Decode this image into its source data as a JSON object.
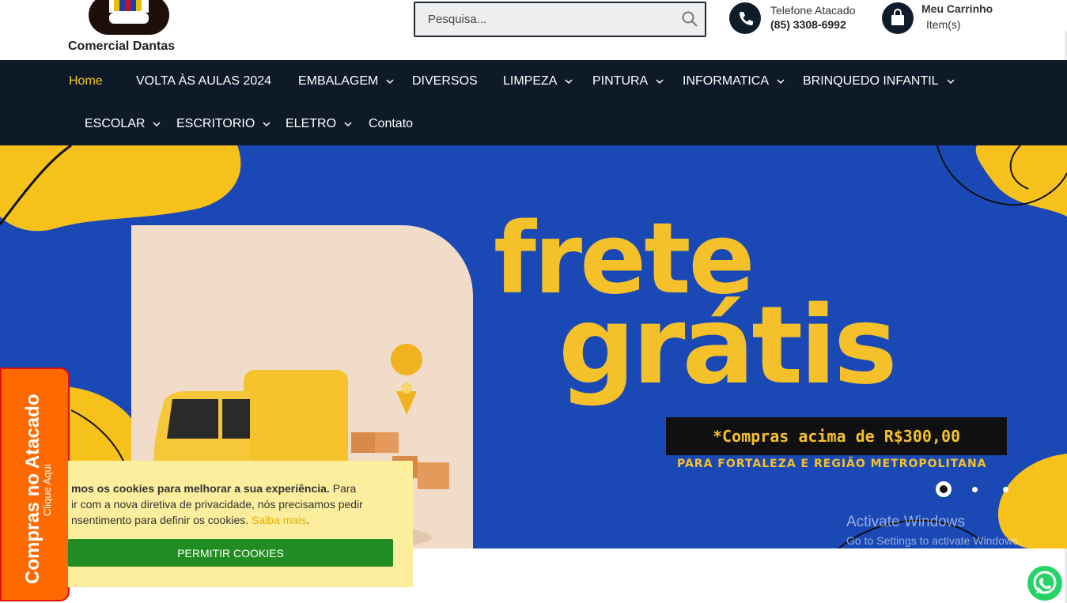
{
  "brand": {
    "name": "Comercial Dantas"
  },
  "search": {
    "placeholder": "Pesquisa..."
  },
  "contact": {
    "label": "Telefone Atacado",
    "phone": "(85) 3308-6992"
  },
  "cart": {
    "label": "Meu Carrinho",
    "items": "Item(s)"
  },
  "nav": {
    "items": [
      {
        "label": "Home",
        "dropdown": false,
        "active": true
      },
      {
        "label": "VOLTA ÀS AULAS 2024",
        "dropdown": false
      },
      {
        "label": "EMBALAGEM",
        "dropdown": true
      },
      {
        "label": "DIVERSOS",
        "dropdown": false
      },
      {
        "label": "LIMPEZA",
        "dropdown": true
      },
      {
        "label": "PINTURA",
        "dropdown": true
      },
      {
        "label": "INFORMATICA",
        "dropdown": true
      },
      {
        "label": "BRINQUEDO INFANTIL",
        "dropdown": true
      },
      {
        "label": "ESCOLAR",
        "dropdown": true
      },
      {
        "label": "ESCRITORIO",
        "dropdown": true
      },
      {
        "label": "ELETRO",
        "dropdown": true
      },
      {
        "label": "Contato",
        "dropdown": false
      }
    ]
  },
  "hero": {
    "headline1": "frete",
    "headline2": "grátis",
    "promo": "*Compras acima de R$300,00",
    "region": "PARA FORTALEZA E REGIÃO METROPOLITANA",
    "slides_total": 3,
    "slide_active": 1
  },
  "side_tab": {
    "title": "Compras no Atacado",
    "subtitle": "Clique Aqui"
  },
  "cookie": {
    "bold": "mos os cookies para melhorar a sua experiência.",
    "text": " Para\nir com a nova diretiva de privacidade, nós precisamos pedir\nnsentimento para definir os cookies. ",
    "more": "Saiba mais",
    "after": ".",
    "button": "PERMITIR COOKIES"
  },
  "os_watermark": {
    "line1": "Activate Windows",
    "line2": "Go to Settings to activate Windows."
  },
  "colors": {
    "nav_bg": "#0e1a28",
    "accent_yellow": "#f5c12a",
    "hero_blue": "#1a49b6",
    "side_tab": "#ff6a00",
    "cookie_bg": "#fcee9c",
    "cookie_button": "#218c21",
    "whatsapp": "#25d366"
  }
}
